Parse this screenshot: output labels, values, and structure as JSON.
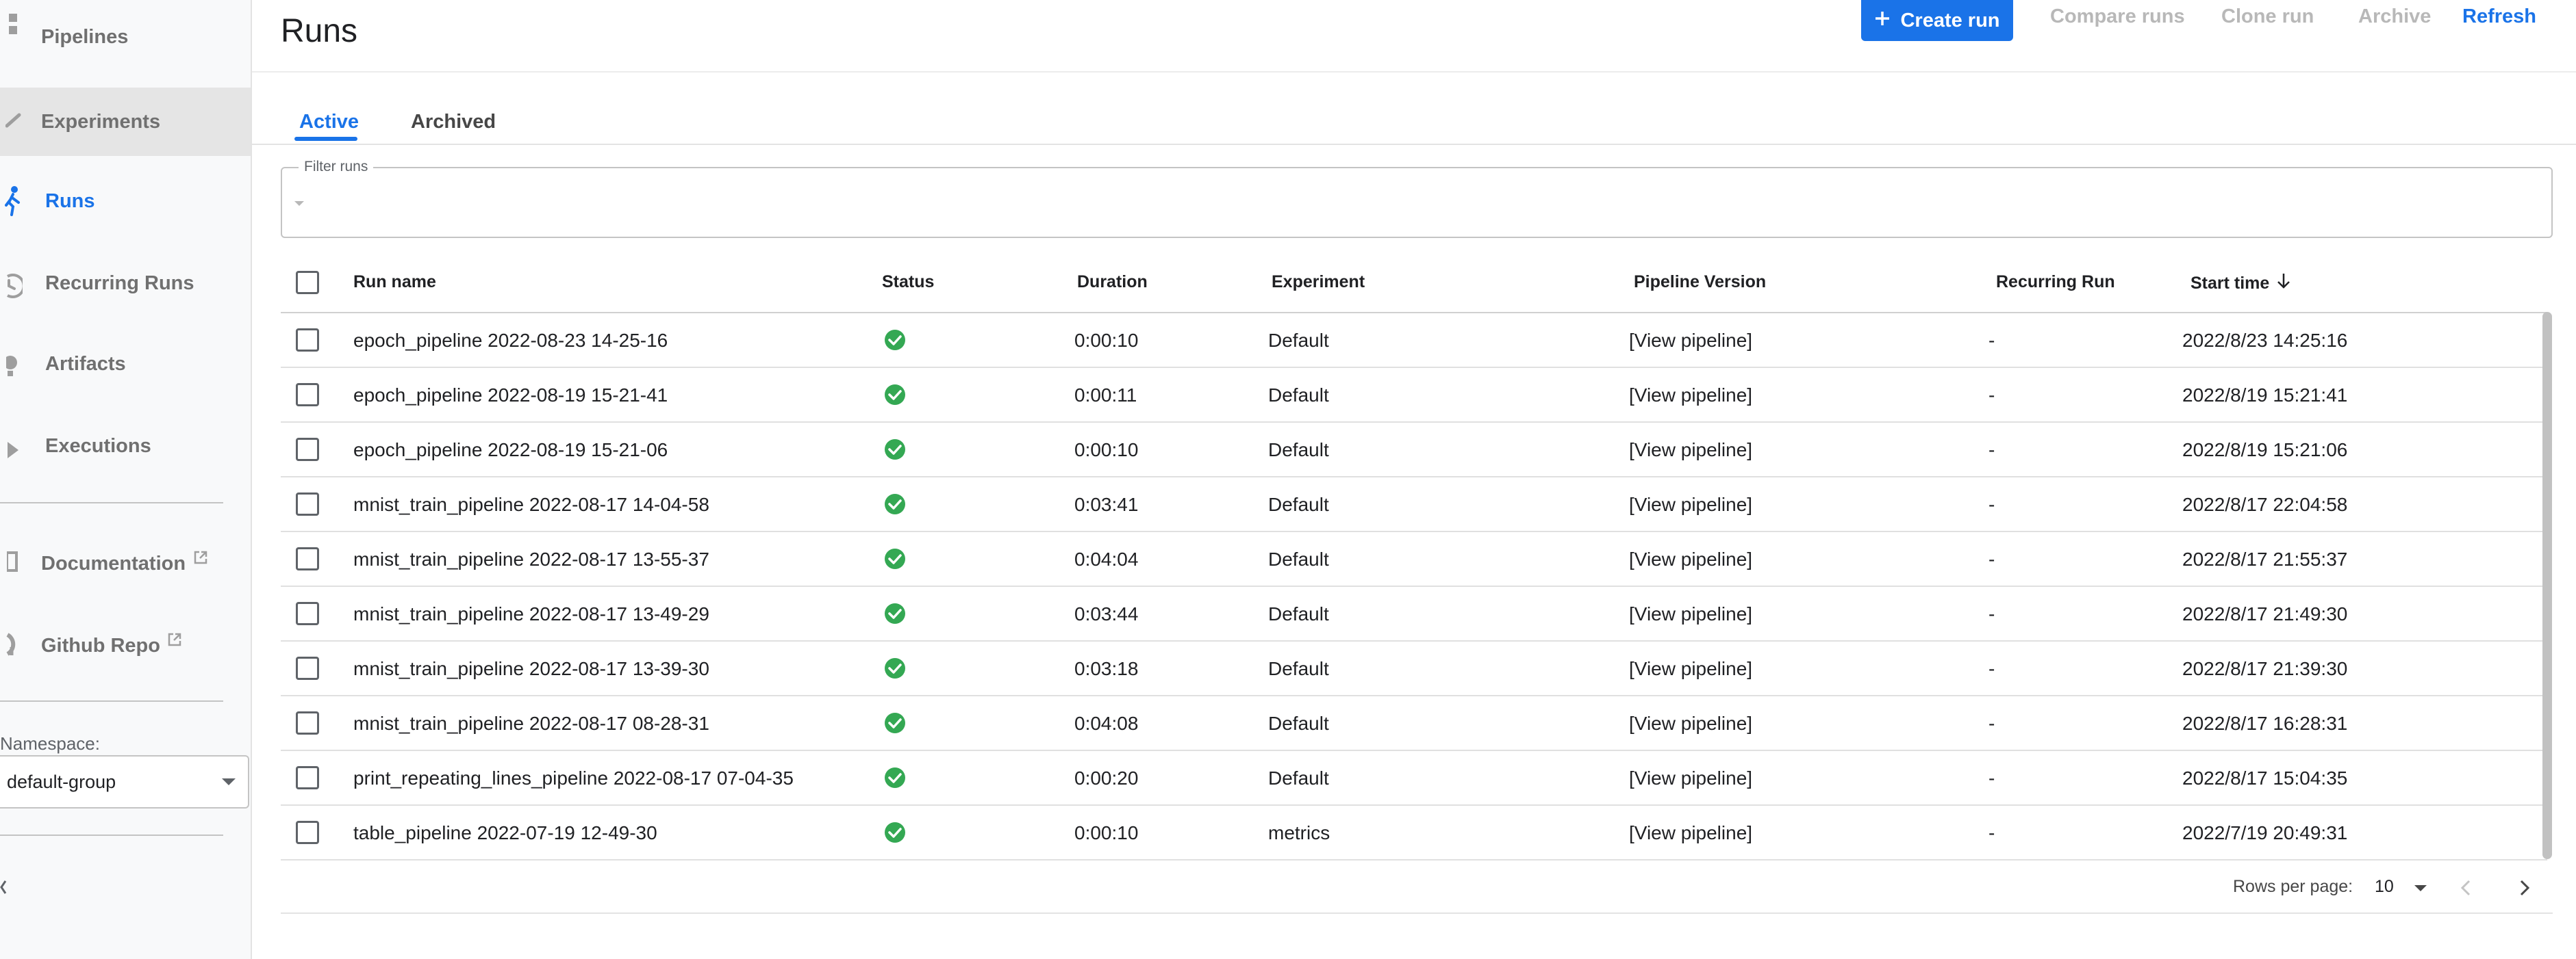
{
  "sidebar": {
    "items": [
      {
        "label": "Pipelines"
      },
      {
        "label": "Experiments"
      },
      {
        "label": "Runs"
      },
      {
        "label": "Recurring Runs"
      },
      {
        "label": "Artifacts"
      },
      {
        "label": "Executions"
      },
      {
        "label": "Documentation"
      },
      {
        "label": "Github Repo"
      }
    ],
    "namespace_label": "Namespace:",
    "namespace_value": "default-group"
  },
  "header": {
    "title": "Runs",
    "create_label": "Create run",
    "compare_label": "Compare runs",
    "clone_label": "Clone run",
    "archive_label": "Archive",
    "refresh_label": "Refresh"
  },
  "tabs": [
    {
      "label": "Active"
    },
    {
      "label": "Archived"
    }
  ],
  "filter": {
    "label": "Filter runs"
  },
  "table": {
    "columns": [
      "Run name",
      "Status",
      "Duration",
      "Experiment",
      "Pipeline Version",
      "Recurring Run",
      "Start time"
    ],
    "rows": [
      {
        "name": "epoch_pipeline 2022-08-23 14-25-16",
        "duration": "0:00:10",
        "experiment": "Default",
        "pipeline": "[View pipeline]",
        "recurring": "-",
        "start": "2022/8/23 14:25:16"
      },
      {
        "name": "epoch_pipeline 2022-08-19 15-21-41",
        "duration": "0:00:11",
        "experiment": "Default",
        "pipeline": "[View pipeline]",
        "recurring": "-",
        "start": "2022/8/19 15:21:41"
      },
      {
        "name": "epoch_pipeline 2022-08-19 15-21-06",
        "duration": "0:00:10",
        "experiment": "Default",
        "pipeline": "[View pipeline]",
        "recurring": "-",
        "start": "2022/8/19 15:21:06"
      },
      {
        "name": "mnist_train_pipeline 2022-08-17 14-04-58",
        "duration": "0:03:41",
        "experiment": "Default",
        "pipeline": "[View pipeline]",
        "recurring": "-",
        "start": "2022/8/17 22:04:58"
      },
      {
        "name": "mnist_train_pipeline 2022-08-17 13-55-37",
        "duration": "0:04:04",
        "experiment": "Default",
        "pipeline": "[View pipeline]",
        "recurring": "-",
        "start": "2022/8/17 21:55:37"
      },
      {
        "name": "mnist_train_pipeline 2022-08-17 13-49-29",
        "duration": "0:03:44",
        "experiment": "Default",
        "pipeline": "[View pipeline]",
        "recurring": "-",
        "start": "2022/8/17 21:49:30"
      },
      {
        "name": "mnist_train_pipeline 2022-08-17 13-39-30",
        "duration": "0:03:18",
        "experiment": "Default",
        "pipeline": "[View pipeline]",
        "recurring": "-",
        "start": "2022/8/17 21:39:30"
      },
      {
        "name": "mnist_train_pipeline 2022-08-17 08-28-31",
        "duration": "0:04:08",
        "experiment": "Default",
        "pipeline": "[View pipeline]",
        "recurring": "-",
        "start": "2022/8/17 16:28:31"
      },
      {
        "name": "print_repeating_lines_pipeline 2022-08-17 07-04-35",
        "duration": "0:00:20",
        "experiment": "Default",
        "pipeline": "[View pipeline]",
        "recurring": "-",
        "start": "2022/8/17 15:04:35"
      },
      {
        "name": "table_pipeline 2022-07-19 12-49-30",
        "duration": "0:00:10",
        "experiment": "metrics",
        "pipeline": "[View pipeline]",
        "recurring": "-",
        "start": "2022/7/19 20:49:31"
      }
    ]
  },
  "pagination": {
    "rows_per_page_label": "Rows per page:",
    "rows_per_page_value": "10"
  },
  "colors": {
    "accent": "#1a73e8",
    "success": "#34a853",
    "disabled_text": "#b8b8b8"
  },
  "icons": [
    "pipelines-icon",
    "experiments-icon",
    "runs-icon",
    "recurring-runs-icon",
    "artifacts-icon",
    "executions-icon",
    "external-link-icon",
    "github-icon",
    "plus-icon",
    "success-status-icon",
    "sort-arrow-down-icon",
    "chevron-left-icon",
    "chevron-right-icon",
    "caret-down-icon"
  ]
}
